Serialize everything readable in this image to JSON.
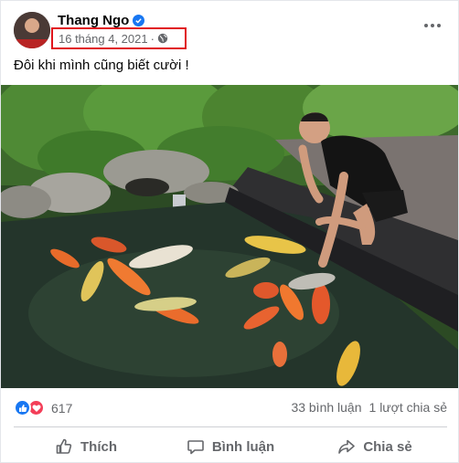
{
  "post": {
    "author": "Thang Ngo",
    "date": "16 tháng 4, 2021",
    "separator": "·",
    "audience_icon": "globe-icon",
    "verified_icon": "verified-badge-icon",
    "caption": "Đôi khi mình cũng biết cười !"
  },
  "stats": {
    "reaction_icons": [
      "like-reaction-icon",
      "love-reaction-icon"
    ],
    "reaction_count": "617",
    "comments": "33 bình luận",
    "shares": "1 lượt chia sẻ"
  },
  "actions": {
    "like": "Thích",
    "comment": "Bình luận",
    "share": "Chia sẻ"
  },
  "colors": {
    "brand": "#1877f2",
    "love": "#f33e58",
    "highlight_box": "#e0141b",
    "secondary_text": "#65676b"
  }
}
